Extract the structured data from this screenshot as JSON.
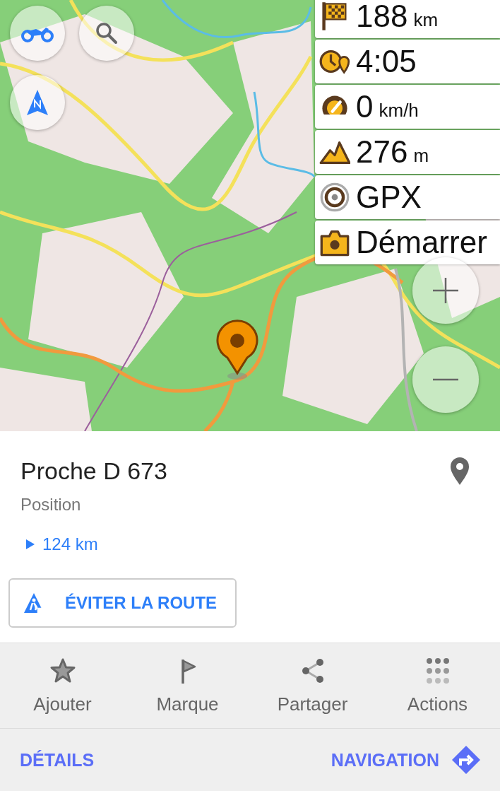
{
  "map_buttons": [
    {
      "kind": "profile"
    },
    {
      "kind": "search"
    },
    {
      "kind": "compass"
    }
  ],
  "zoom_buttons": [
    {
      "kind": "zoom-in"
    },
    {
      "kind": "zoom-out"
    }
  ],
  "widgets": [
    {
      "kind": "distance",
      "value": "188",
      "unit": "km"
    },
    {
      "kind": "time",
      "value": "4:05"
    },
    {
      "kind": "speed",
      "value": "0",
      "unit": "km/h"
    },
    {
      "kind": "altitude",
      "value": "276",
      "unit": "m"
    },
    {
      "kind": "gpx",
      "value": "GPX"
    },
    {
      "kind": "camera",
      "value": "Démarrer"
    }
  ],
  "place": {
    "title": "Proche D 673",
    "subtitle": "Position",
    "distance": "124 km"
  },
  "avoid_button": {
    "label": "ÉVITER LA ROUTE"
  },
  "actions": [
    {
      "kind": "star",
      "label": "Ajouter"
    },
    {
      "kind": "flag",
      "label": "Marque"
    },
    {
      "kind": "share",
      "label": "Partager"
    },
    {
      "kind": "dots",
      "label": "Actions"
    }
  ],
  "footer": {
    "details": "DÉTAILS",
    "navigation": "NAVIGATION"
  }
}
